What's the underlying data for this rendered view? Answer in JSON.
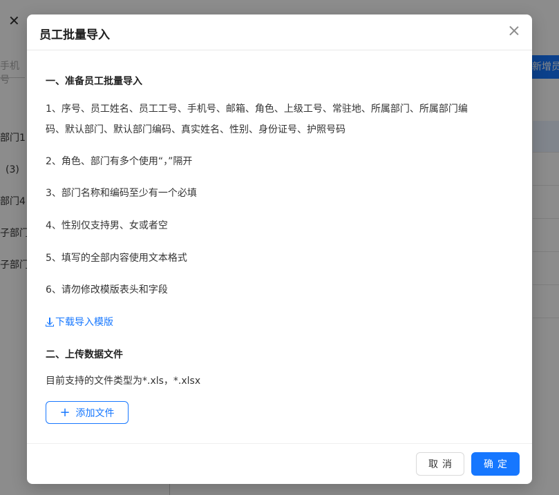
{
  "background": {
    "search_placeholder": "手机号",
    "add_button_label": "新增员",
    "tree_items": [
      "部门1",
      "(3)",
      "部门4",
      "子部门",
      "子部门"
    ]
  },
  "modal": {
    "title": "员工批量导入",
    "section1_title": "一、准备员工批量导入",
    "instructions": [
      "1、序号、员工姓名、员工工号、手机号、邮箱、角色、上级工号、常驻地、所属部门、所属部门编",
      "码、默认部门、默认部门编码、真实姓名、性别、身份证号、护照号码",
      "2、角色、部门有多个使用“，”隔开",
      "3、部门名称和编码至少有一个必填",
      "4、性别仅支持男、女或者空",
      "5、填写的全部内容使用文本格式",
      "6、请勿修改模版表头和字段"
    ],
    "download_link": "下载导入模版",
    "section2_title": "二、上传数据文件",
    "file_types_text": "目前支持的文件类型为*.xls，*.xlsx",
    "add_file_button": "添加文件",
    "cancel_button": "取消",
    "ok_button": "确定"
  },
  "colors": {
    "primary": "#1677ff",
    "mask": "rgba(0,0,0,0.45)"
  }
}
